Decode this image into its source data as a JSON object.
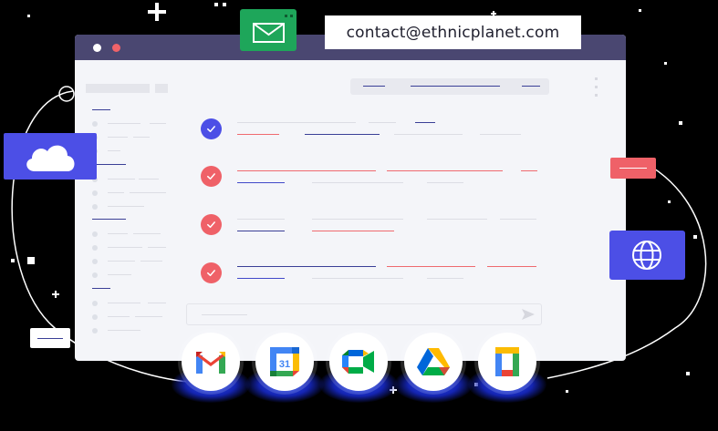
{
  "contact": {
    "email": "contact@ethnicplanet.com"
  },
  "icons": {
    "mail": "envelope-icon",
    "cloud": "cloud-icon",
    "globe": "globe-icon",
    "check": "check-icon",
    "send": "send-icon"
  },
  "apps": [
    {
      "name": "gmail",
      "icon": "gmail-icon"
    },
    {
      "name": "google-calendar",
      "icon": "google-calendar-icon",
      "label": "31"
    },
    {
      "name": "google-meet",
      "icon": "google-meet-icon"
    },
    {
      "name": "google-drive",
      "icon": "google-drive-icon"
    },
    {
      "name": "google-docs",
      "icon": "google-docs-icon"
    }
  ],
  "colors": {
    "accent_blue": "#4c4fe6",
    "accent_red": "#ef6168",
    "mail_green": "#1ea65a",
    "window_bar": "#4a4771"
  }
}
